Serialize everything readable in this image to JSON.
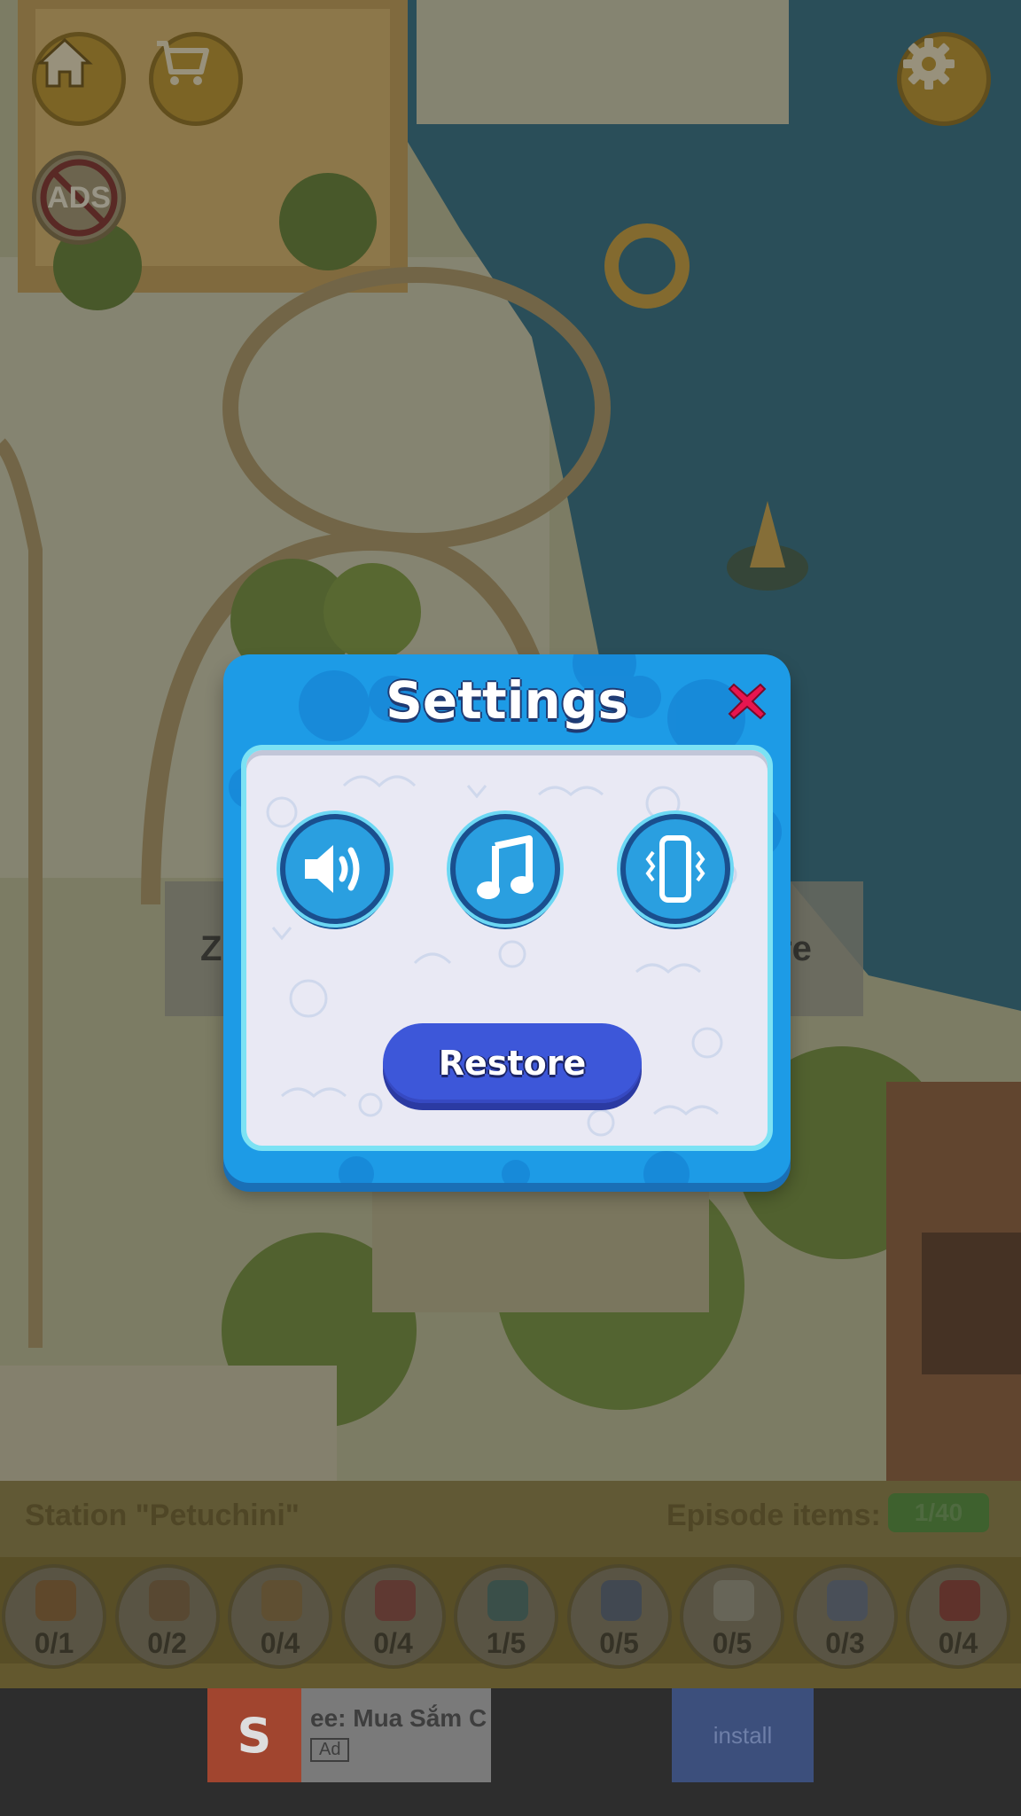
{
  "hud": {
    "home_icon": "home-icon",
    "shop_icon": "cart-icon",
    "no_ads_label": "ADS",
    "settings_icon": "gear-icon"
  },
  "background": {
    "zone_left_text": "Z",
    "zone_right_text": "re"
  },
  "settings_dialog": {
    "title": "Settings",
    "close_icon": "close-icon",
    "toggles": [
      {
        "name": "sound",
        "icon": "speaker-icon"
      },
      {
        "name": "music",
        "icon": "music-note-icon"
      },
      {
        "name": "vibration",
        "icon": "vibration-phone-icon"
      }
    ],
    "restore_label": "Restore",
    "colors": {
      "frame": "#1d9be6",
      "panel": "#e9e9f4",
      "button": "#3d57d9",
      "close": "#e8154f"
    }
  },
  "items_bar": {
    "station_label": "Station \"Petuchini\"",
    "episode_label": "Episode items:",
    "episode_count": "1/40",
    "items": [
      {
        "icon": "basketball-icon",
        "count": "0/1"
      },
      {
        "icon": "boomerang-icon",
        "count": "0/2"
      },
      {
        "icon": "pizza-slice-icon",
        "count": "0/4"
      },
      {
        "icon": "ring-icon",
        "count": "0/4"
      },
      {
        "icon": "kettlebell-icon",
        "count": "1/5"
      },
      {
        "icon": "hat-icon",
        "count": "0/5"
      },
      {
        "icon": "toilet-paper-icon",
        "count": "0/5"
      },
      {
        "icon": "sandal-icon",
        "count": "0/3"
      },
      {
        "icon": "mushroom-icon",
        "count": "0/4"
      }
    ]
  },
  "ad_banner": {
    "title": "ee: Mua Sắm C",
    "tag": "Ad",
    "install": "install"
  }
}
